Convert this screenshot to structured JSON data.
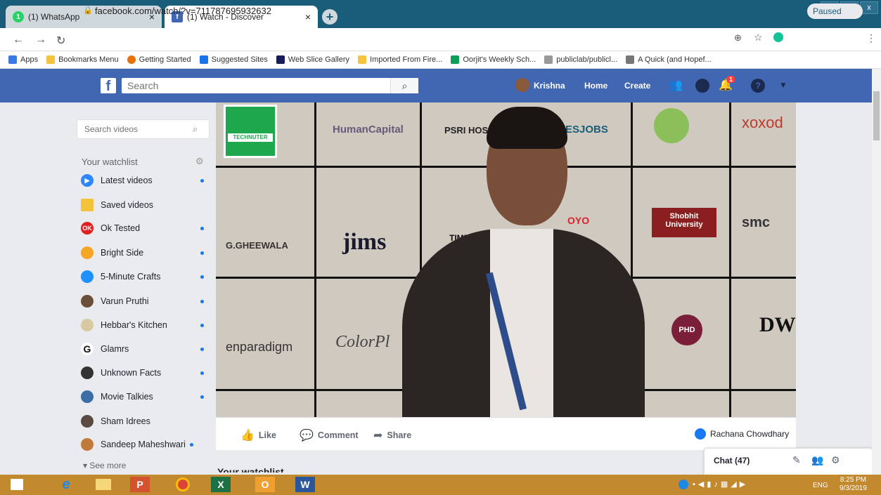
{
  "browser": {
    "tabs": [
      {
        "title": "(1) WhatsApp",
        "badge": "1"
      },
      {
        "title": "(1) Watch - Discover",
        "badge": "f"
      }
    ],
    "close_glyph": "×",
    "new_tab_glyph": "+",
    "url": "facebook.com/watch/?v=711787695932632",
    "paused_label": "Paused",
    "window_controls": [
      "–",
      "▫",
      "x"
    ],
    "bookmarks": [
      {
        "label": "Apps",
        "color": "#3b78e7"
      },
      {
        "label": "Bookmarks Menu",
        "color": "#f7c23e"
      },
      {
        "label": "Getting Started",
        "color": "#e8710a"
      },
      {
        "label": "Suggested Sites",
        "color": "#1a73e8"
      },
      {
        "label": "Web Slice Gallery",
        "color": "#1a1a5e"
      },
      {
        "label": "Imported From Fire...",
        "color": "#f7c23e"
      },
      {
        "label": "Oorjit's Weekly Sch...",
        "color": "#0f9d58"
      },
      {
        "label": "publiclab/publicl...",
        "color": "#999999"
      },
      {
        "label": "A Quick (and Hopef...",
        "color": "#777777"
      }
    ]
  },
  "facebook": {
    "search_placeholder": "Search",
    "user_name": "Krishna",
    "nav": [
      "Home",
      "Create"
    ],
    "notification_count": "1",
    "brand_color": "#4267b2"
  },
  "sidebar": {
    "search_placeholder": "Search videos",
    "watchlist_title": "Your watchlist",
    "items": [
      {
        "label": "Latest videos",
        "color": "#2d88ff",
        "dot": true
      },
      {
        "label": "Saved videos",
        "color": "#f5c33b",
        "dot": false
      },
      {
        "label": "Ok Tested",
        "color": "#e02020",
        "dot": true
      },
      {
        "label": "Bright Side",
        "color": "#f5a623",
        "dot": true
      },
      {
        "label": "5-Minute Crafts",
        "color": "#1e90ff",
        "dot": true
      },
      {
        "label": "Varun Pruthi",
        "color": "#6b4f3a",
        "dot": true
      },
      {
        "label": "Hebbar's Kitchen",
        "color": "#d9c9a3",
        "dot": true
      },
      {
        "label": "Glamrs",
        "color": "#ffffff",
        "dot": true
      },
      {
        "label": "Unknown Facts",
        "color": "#333333",
        "dot": true
      },
      {
        "label": "Movie Talkies",
        "color": "#3a6ea5",
        "dot": true
      },
      {
        "label": "Sham Idrees",
        "color": "#5a4a42",
        "dot": false
      },
      {
        "label": "Sandeep Maheshwari",
        "color": "#c07a3a",
        "dot": true
      }
    ],
    "see_more": "See more"
  },
  "video": {
    "brands": [
      "TECHNUTER",
      "HumanCapital",
      "PSRI HOS",
      "ESJOBS",
      "xoxod",
      "G.GHEEWALA",
      "jims",
      "TIMES",
      "OYO",
      "Shobhit University",
      "smc",
      "enparadigm",
      "ColorPl",
      "PHD",
      "DW"
    ],
    "actions": {
      "like": "Like",
      "comment": "Comment",
      "share": "Share"
    },
    "channel": "Rachana Chowdhary"
  },
  "below": {
    "heading": "Your watchlist"
  },
  "chat": {
    "label": "Chat (47)"
  },
  "taskbar": {
    "apps": [
      "e",
      "P",
      "X",
      "O",
      "W"
    ],
    "language": "ENG",
    "time": "8:25 PM",
    "date": "9/3/2019"
  }
}
